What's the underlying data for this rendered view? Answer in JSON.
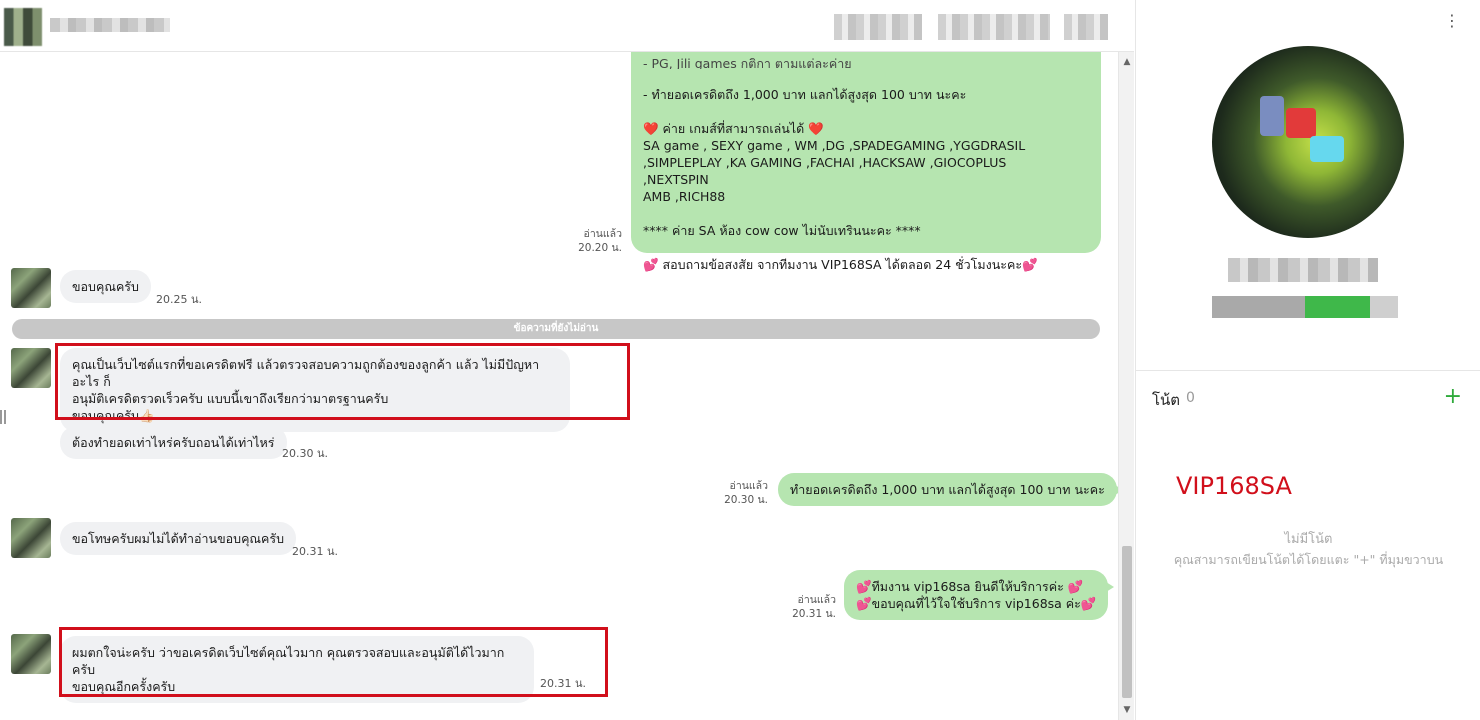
{
  "messages": {
    "m1": {
      "text": "- ทำยอดเครดิตถึง 1,000 บาท แลกได้สูงสุด 100 บาท นะคะ\n\n❤️ ค่าย เกมส์ที่สามารถเล่นได้ ❤️\nSA game , SEXY game , WM ,DG  ,SPADEGAMING ,YGGDRASIL\n,SIMPLEPLAY ,KA GAMING ,FACHAI  ,HACKSAW ,GIOCOPLUS\n,NEXTSPIN\nAMB ,RICH88\n\n**** ค่าย SA ห้อง cow cow ไม่นับเทรินนะคะ ****\n\n💕 สอบถามข้อสงสัย จากทีมงาน VIP168SA ได้ตลอด 24 ชั่วโมงนะคะ💕",
      "read": "อ่านแล้ว",
      "time": "20.20 น."
    },
    "m2": {
      "text": "ขอบคุณครับ",
      "time": "20.25 น."
    },
    "divider": "ข้อความที่ยังไม่อ่าน",
    "m3": {
      "text": "คุณเป็นเว็บไซต์แรกที่ขอเครดิตฟรี แล้วตรวจสอบความถูกต้องของลูกค้า แล้ว ไม่มีปัญหาอะไร ก็\nอนุมัติเครดิตรวดเร็วครับ แบบนี้เขาถึงเรียกว่ามาตรฐานครับ\nขอบคุณครับ👍🏻"
    },
    "m4": {
      "text": "ต้องทำยอดเท่าไหร่ครับถอนได้เท่าไหร่",
      "time": "20.30 น."
    },
    "m5": {
      "text": "ทำยอดเครดิตถึง 1,000 บาท แลกได้สูงสุด 100 บาท นะคะ",
      "read": "อ่านแล้ว",
      "time": "20.30 น."
    },
    "m6": {
      "text": "ขอโทษครับผมไม่ได้ทำอ่านขอบคุณครับ",
      "time": "20.31 น."
    },
    "m7": {
      "text": "💕ทีมงาน vip168sa ยินดีให้บริการค่ะ 💕\n💕ขอบคุณที่ไว้ใจใช้บริการ vip168sa ค่ะ💕",
      "read": "อ่านแล้ว",
      "time": "20.31 น."
    },
    "m8": {
      "text": "ผมตกใจน่ะครับ ว่าขอเครดิตเว็บไซต์คุณไวมาก คุณตรวจสอบและอนุมัติได้ไวมากครับ\nขอบคุณอีกครั้งครับ",
      "time": "20.31 น."
    }
  },
  "panel": {
    "menu_icon": "⋮",
    "note_label": "โน้ต",
    "note_count": "0",
    "add_icon": "+",
    "brand_text": "VIP168SA",
    "empty_title": "ไม่มีโน้ต",
    "empty_subtitle": "คุณสามารถเขียนโน้ตได้โดยแตะ \"+\" ที่มุมขวาบน"
  },
  "colors": {
    "outgoing_bubble": "#b6e5b0",
    "incoming_bubble": "#f0f1f3",
    "highlight_box": "#d10f1b",
    "accent_green": "#2faa3b"
  }
}
